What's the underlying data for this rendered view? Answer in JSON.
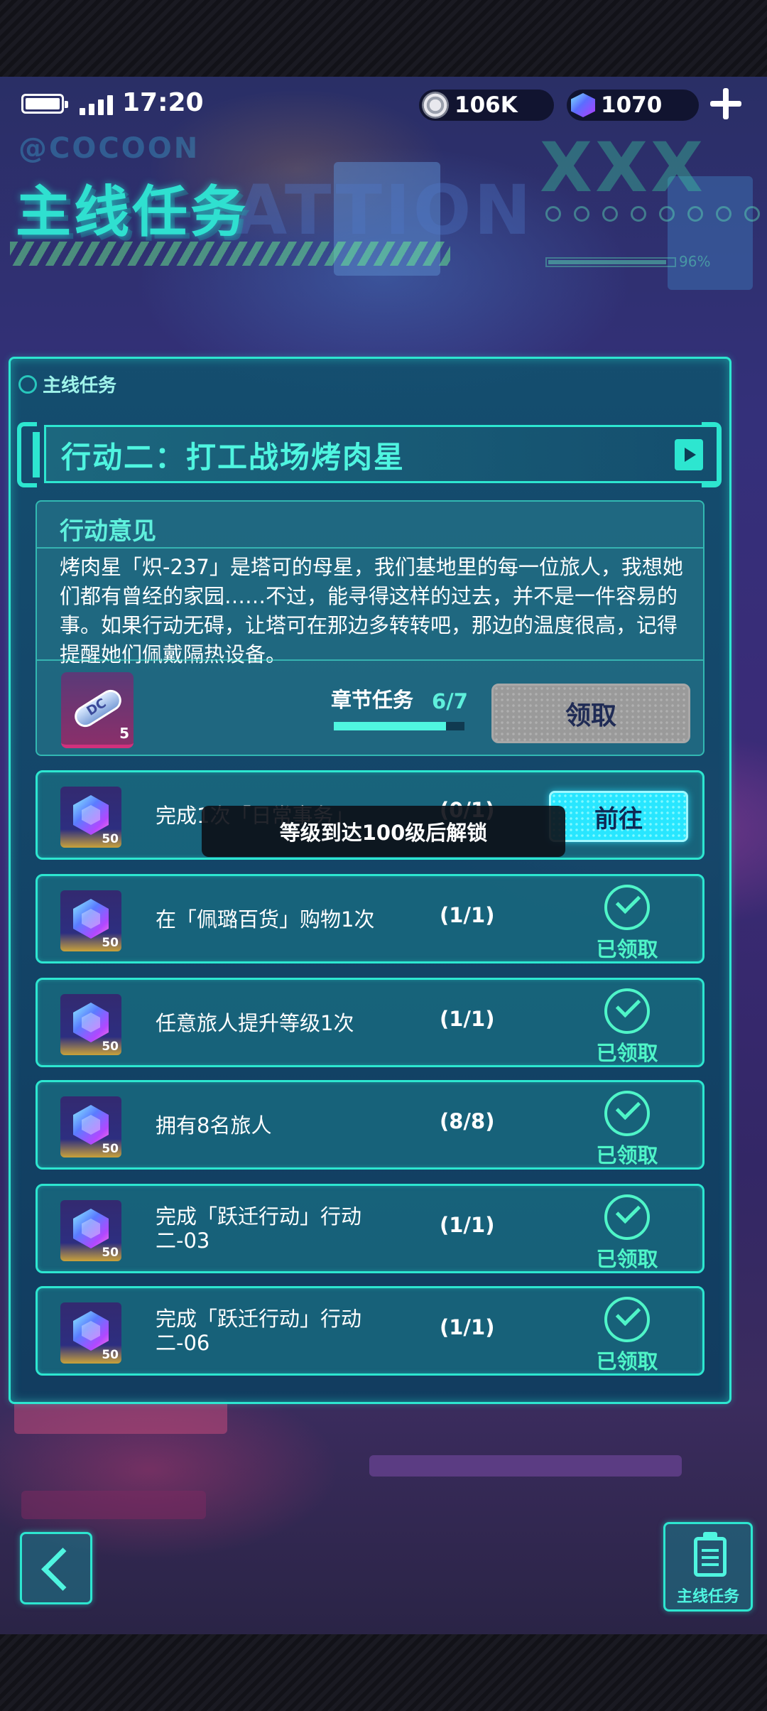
{
  "status": {
    "time": "17:20"
  },
  "currency": {
    "coins": "106K",
    "gems": "1070"
  },
  "header": {
    "cocoon": "@COCOON",
    "title": "主线任务",
    "ghost": "ATTION",
    "deco_x": "XXX",
    "deco_pct": "96%"
  },
  "panel": {
    "tag": "主线任务"
  },
  "chapter": {
    "name": "行动二：打工战场烤肉星"
  },
  "opinion": {
    "heading": "行动意见",
    "text": "烤肉星「炽-237」是塔可的母星，我们基地里的每一位旅人，我想她们都有曾经的家园……不过，能寻得这样的过去，并不是一件容易的事。如果行动无碍，让塔可在那边多转转吧，那边的温度很高，记得提醒她们佩戴隔热设备。"
  },
  "chapter_task": {
    "label": "章节任务",
    "count": "6/7",
    "progress": 0.857,
    "item_qty": "5",
    "claim_label": "领取"
  },
  "tasks": [
    {
      "desc": "完成1次「日常事务」",
      "progress": "(0/1)",
      "reward_qty": "50",
      "action": "前往"
    },
    {
      "desc": "在「佩璐百货」购物1次",
      "progress": "(1/1)",
      "reward_qty": "50",
      "status": "已领取"
    },
    {
      "desc": "任意旅人提升等级1次",
      "progress": "(1/1)",
      "reward_qty": "50",
      "status": "已领取"
    },
    {
      "desc": "拥有8名旅人",
      "progress": "(8/8)",
      "reward_qty": "50",
      "status": "已领取"
    },
    {
      "desc": "完成「跃迁行动」行动二-03",
      "progress": "(1/1)",
      "reward_qty": "50",
      "status": "已领取"
    },
    {
      "desc": "完成「跃迁行动」行动二-06",
      "progress": "(1/1)",
      "reward_qty": "50",
      "status": "已领取"
    }
  ],
  "toast": "等级到达100级后解锁",
  "nav": {
    "main_task_label": "主线任务"
  }
}
